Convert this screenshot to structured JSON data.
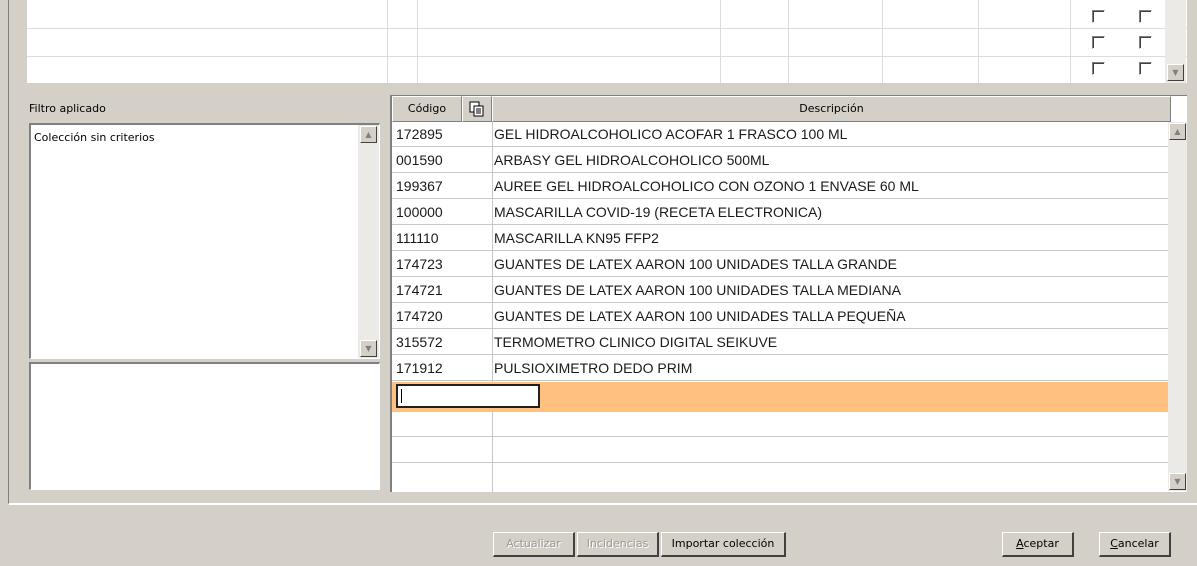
{
  "filter": {
    "label": "Filtro aplicado",
    "value": "Colección sin criterios"
  },
  "grid": {
    "columns": [
      "Código",
      "Descripción"
    ],
    "rows": [
      {
        "code": "172895",
        "desc": "GEL HIDROALCOHOLICO ACOFAR 1 FRASCO 100 ML"
      },
      {
        "code": "001590",
        "desc": "ARBASY GEL HIDROALCOHOLICO 500ML"
      },
      {
        "code": "199367",
        "desc": "AUREE GEL HIDROALCOHOLICO CON OZONO  1 ENVASE 60 ML"
      },
      {
        "code": "100000",
        "desc": "MASCARILLA COVID-19 (RECETA ELECTRONICA)"
      },
      {
        "code": "111110",
        "desc": "MASCARILLA KN95 FFP2"
      },
      {
        "code": "174723",
        "desc": "GUANTES DE LATEX AARON 100 UNIDADES TALLA GRANDE"
      },
      {
        "code": "174721",
        "desc": "GUANTES DE LATEX AARON 100 UNIDADES TALLA MEDIANA"
      },
      {
        "code": "174720",
        "desc": "GUANTES DE LATEX AARON 100 UNIDADES TALLA PEQUEÑA"
      },
      {
        "code": "315572",
        "desc": "TERMOMETRO CLINICO DIGITAL SEIKUVE"
      },
      {
        "code": "171912",
        "desc": "PULSIOXIMETRO DEDO PRIM"
      }
    ],
    "active_row_color": "#ffc080",
    "header_icon": "copy-icon"
  },
  "buttons": {
    "actualizar": "Actualizar",
    "incidencias": "Incidencias",
    "importar": "Importar colección",
    "aceptar_key": "A",
    "aceptar_rest": "ceptar",
    "cancelar_key": "C",
    "cancelar_rest": "ancelar"
  }
}
